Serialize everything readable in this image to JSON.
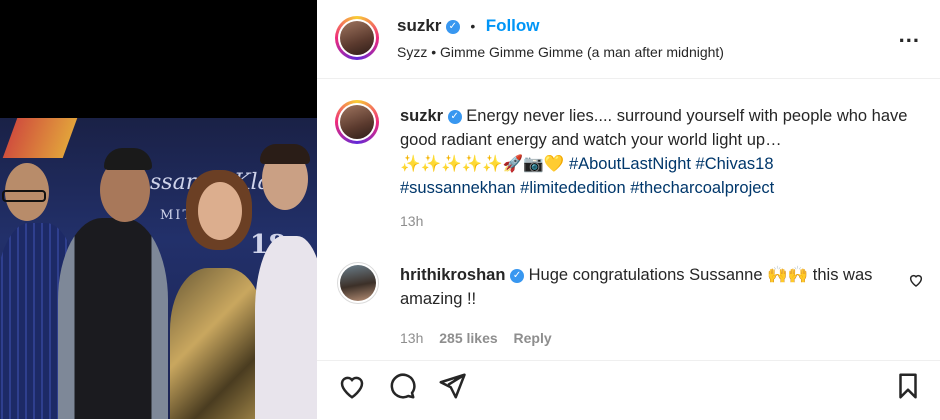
{
  "post": {
    "author": "suzkr",
    "follow_label": "Follow",
    "audio": "Syzz • Gimme Gimme Gimme (a man after midnight)",
    "more_label": "...",
    "caption": "Energy never lies.... surround yourself with people who have good radiant energy and watch your world light up…",
    "emojis": "✨✨✨✨✨🚀📷💛",
    "hashtags_line1": "#AboutLastNight #Chivas18",
    "hashtags_line2": "#sussannekhan #limitededition #thecharcoalproject",
    "caption_time": "13h"
  },
  "comment": {
    "author": "hrithikroshan",
    "text": "Huge congratulations Sussanne 🙌🙌 this was amazing !!",
    "time": "13h",
    "likes": "285 likes",
    "reply_label": "Reply"
  },
  "photo": {
    "sign_text": "ssanne Klan",
    "sign_text2": "MITED E",
    "sign_num": "18"
  },
  "colors": {
    "link": "#00376b",
    "follow": "#0095f6",
    "muted": "#8e8e8e"
  }
}
